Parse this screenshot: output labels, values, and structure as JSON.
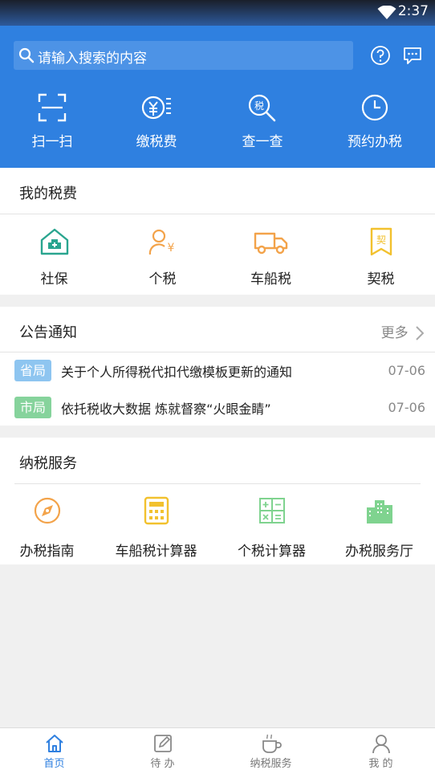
{
  "status_bar": {
    "time": "2:37"
  },
  "header": {
    "search_placeholder": "请输入搜索的内容",
    "quick_actions": [
      {
        "label": "扫一扫",
        "icon": "scan-icon"
      },
      {
        "label": "缴税费",
        "icon": "pay-tax-icon"
      },
      {
        "label": "查一查",
        "icon": "tax-search-icon"
      },
      {
        "label": "预约办税",
        "icon": "clock-icon"
      }
    ]
  },
  "my_tax": {
    "title": "我的税费",
    "items": [
      {
        "label": "社保",
        "icon": "social-security-icon"
      },
      {
        "label": "个税",
        "icon": "personal-tax-icon"
      },
      {
        "label": "车船税",
        "icon": "truck-icon"
      },
      {
        "label": "契税",
        "icon": "deed-tax-icon"
      }
    ]
  },
  "notices": {
    "title": "公告通知",
    "more_label": "更多",
    "items": [
      {
        "badge": "省局",
        "title": "关于个人所得税代扣代缴模板更新的通知",
        "date": "07-06"
      },
      {
        "badge": "市局",
        "title": "依托税收大数据 炼就督察“火眼金睛”",
        "date": "07-06"
      }
    ]
  },
  "services": {
    "title": "纳税服务",
    "items": [
      {
        "label": "办税指南",
        "icon": "compass-icon"
      },
      {
        "label": "车船税计算器",
        "icon": "calculator-icon"
      },
      {
        "label": "个税计算器",
        "icon": "calc-grid-icon"
      },
      {
        "label": "办税服务厅",
        "icon": "buildings-icon"
      }
    ]
  },
  "tabbar": {
    "tabs": [
      {
        "label": "首页",
        "icon": "home-icon",
        "active": true
      },
      {
        "label": "待 办",
        "icon": "edit-icon",
        "active": false
      },
      {
        "label": "纳税服务",
        "icon": "coffee-icon",
        "active": false
      },
      {
        "label": "我 的",
        "icon": "user-icon",
        "active": false
      }
    ]
  },
  "colors": {
    "brand_blue": "#2f80e0",
    "badge_province": "#8ec5f0",
    "badge_city": "#86d39c",
    "icon_teal": "#2aa58f",
    "icon_orange": "#f3a34a",
    "icon_yellow": "#f2c12e"
  }
}
